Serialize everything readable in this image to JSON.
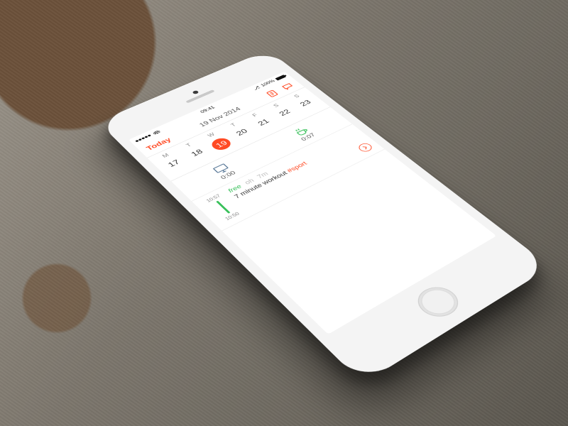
{
  "status": {
    "time": "09:41",
    "battery": "100%"
  },
  "appbar": {
    "title": "Today",
    "date": "19 Nov 2014"
  },
  "week": {
    "dow": [
      "M",
      "T",
      "W",
      "T",
      "F",
      "S",
      "S"
    ],
    "days": [
      "17",
      "18",
      "19",
      "20",
      "21",
      "22",
      "23"
    ],
    "selected_index": 2
  },
  "summary": {
    "work": {
      "value": "0:00"
    },
    "break": {
      "value": "0:07"
    }
  },
  "entry": {
    "start": "10:57",
    "end": "10:50",
    "tag": "free",
    "dur_prefix": "oh",
    "dur": "7m",
    "title": "7 minute workout",
    "hashtag": "#sport"
  }
}
